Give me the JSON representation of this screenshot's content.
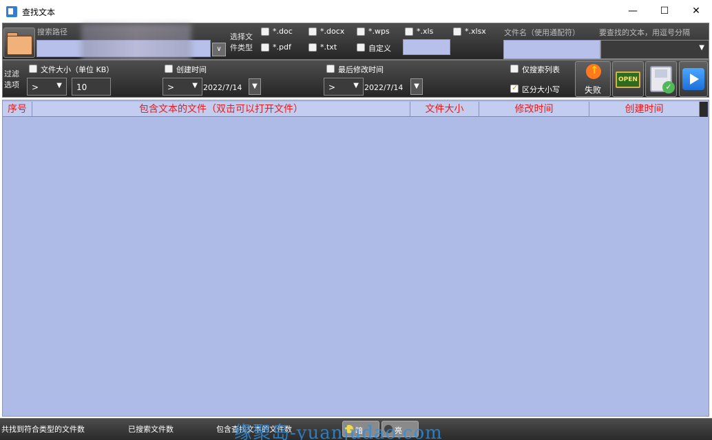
{
  "window": {
    "title": "查找文本",
    "minimize": "—",
    "maximize": "☐",
    "close": "✕"
  },
  "toolbar": {
    "search_path_label": "搜索路径",
    "search_path_value": "",
    "file_type_label_line1": "选择文",
    "file_type_label_line2": "件类型",
    "file_types": [
      {
        "label": "*.doc",
        "checked": false
      },
      {
        "label": "*.docx",
        "checked": false
      },
      {
        "label": "*.wps",
        "checked": false
      },
      {
        "label": "*.xls",
        "checked": false
      },
      {
        "label": "*.xlsx",
        "checked": false
      },
      {
        "label": "*.pdf",
        "checked": false
      },
      {
        "label": "*.txt",
        "checked": false
      },
      {
        "label": "自定义",
        "checked": false
      }
    ],
    "custom_type_value": "",
    "filename_label": "文件名（使用通配符）",
    "filename_value": "",
    "search_text_label": "要查找的文本，用逗号分隔",
    "search_text_value": ""
  },
  "filter": {
    "label_line1": "过滤",
    "label_line2": "选项",
    "file_size_label": "文件大小（单位 KB）",
    "file_size_op": ">",
    "file_size_value": "10",
    "created_label": "创建时间",
    "created_op": ">",
    "created_date": "2022/7/14",
    "modified_label": "最后修改时间",
    "modified_op": ">",
    "modified_date": "2022/7/14",
    "search_list_only_label": "仅搜索列表",
    "search_list_only": false,
    "case_sensitive_label": "区分大小写",
    "case_sensitive": true,
    "fail_button_label": "失败",
    "open_sign_text": "OPEN"
  },
  "table": {
    "columns": [
      "序号",
      "包含文本的文件（双击可以打开文件）",
      "文件大小",
      "修改时间",
      "创建时间"
    ],
    "rows": []
  },
  "status": {
    "matched_types_label": "共找到符合类型的文件数",
    "searched_label": "已搜索文件数",
    "contains_label": "包含查找文本的文件数",
    "toggle_dark": "暗",
    "toggle_light": "亮"
  },
  "watermark": "缘聚岛-yuanjudao.com",
  "colors": {
    "header_text": "#ea1a1a",
    "table_bg": "#aebbe6",
    "toolbar_bg": "#3a3a3a"
  }
}
